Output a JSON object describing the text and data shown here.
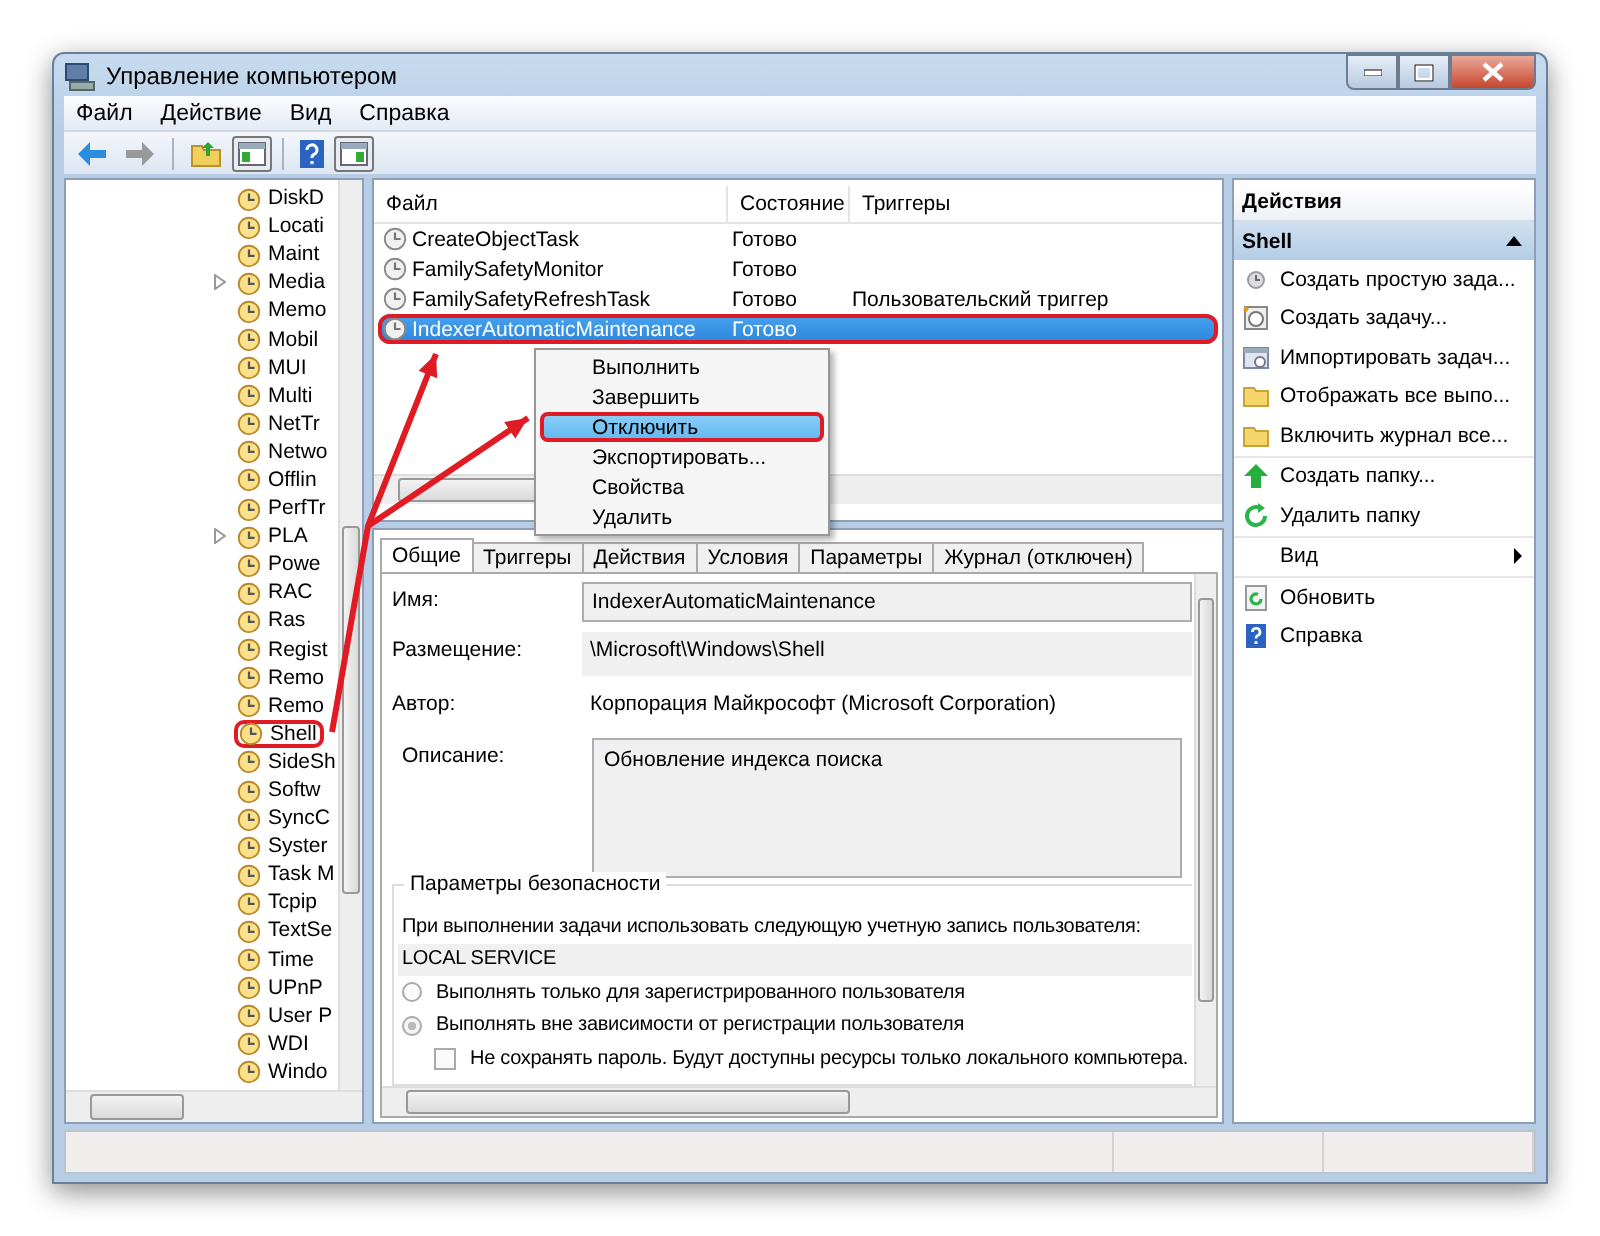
{
  "window": {
    "title": "Управление компьютером"
  },
  "menu": [
    "Файл",
    "Действие",
    "Вид",
    "Справка"
  ],
  "tree": {
    "items": [
      {
        "label": "DiskD",
        "expandable": false,
        "highlighted": false
      },
      {
        "label": "Locati",
        "expandable": false,
        "highlighted": false
      },
      {
        "label": "Maint",
        "expandable": false,
        "highlighted": false
      },
      {
        "label": "Media",
        "expandable": true,
        "highlighted": false
      },
      {
        "label": "Memo",
        "expandable": false,
        "highlighted": false
      },
      {
        "label": "Mobil",
        "expandable": false,
        "highlighted": false
      },
      {
        "label": "MUI",
        "expandable": false,
        "highlighted": false
      },
      {
        "label": "Multi",
        "expandable": false,
        "highlighted": false
      },
      {
        "label": "NetTr",
        "expandable": false,
        "highlighted": false
      },
      {
        "label": "Netwo",
        "expandable": false,
        "highlighted": false
      },
      {
        "label": "Offlin",
        "expandable": false,
        "highlighted": false
      },
      {
        "label": "PerfTr",
        "expandable": false,
        "highlighted": false
      },
      {
        "label": "PLA",
        "expandable": true,
        "highlighted": false
      },
      {
        "label": "Powe",
        "expandable": false,
        "highlighted": false
      },
      {
        "label": "RAC",
        "expandable": false,
        "highlighted": false
      },
      {
        "label": "Ras",
        "expandable": false,
        "highlighted": false
      },
      {
        "label": "Regist",
        "expandable": false,
        "highlighted": false
      },
      {
        "label": "Remo",
        "expandable": false,
        "highlighted": false
      },
      {
        "label": "Remo",
        "expandable": false,
        "highlighted": false
      },
      {
        "label": "Shell",
        "expandable": false,
        "highlighted": true
      },
      {
        "label": "SideSh",
        "expandable": false,
        "highlighted": false
      },
      {
        "label": "Softw",
        "expandable": false,
        "highlighted": false
      },
      {
        "label": "SyncC",
        "expandable": false,
        "highlighted": false
      },
      {
        "label": "Syster",
        "expandable": false,
        "highlighted": false
      },
      {
        "label": "Task M",
        "expandable": false,
        "highlighted": false
      },
      {
        "label": "Tcpip",
        "expandable": false,
        "highlighted": false
      },
      {
        "label": "TextSe",
        "expandable": false,
        "highlighted": false
      },
      {
        "label": "Time",
        "expandable": false,
        "highlighted": false
      },
      {
        "label": "UPnP",
        "expandable": false,
        "highlighted": false
      },
      {
        "label": "User P",
        "expandable": false,
        "highlighted": false
      },
      {
        "label": "WDI",
        "expandable": false,
        "highlighted": false
      },
      {
        "label": "Windo",
        "expandable": false,
        "highlighted": false
      }
    ]
  },
  "tasks": {
    "columns": [
      "Файл",
      "Состояние",
      "Триггеры"
    ],
    "rows": [
      {
        "name": "CreateObjectTask",
        "status": "Готово",
        "selected": false,
        "highlighted": false
      },
      {
        "name": "FamilySafetyMonitor",
        "status": "Готово",
        "selected": false,
        "highlighted": false
      },
      {
        "name": "FamilySafetyRefreshTask",
        "status": "Готово",
        "triggers": "Пользовательский триггер",
        "selected": false,
        "highlighted": false
      },
      {
        "name": "IndexerAutomaticMaintenance",
        "status": "Готово",
        "selected": true,
        "highlighted": true
      }
    ]
  },
  "context_menu": {
    "items": [
      {
        "label": "Выполнить",
        "selected": false,
        "highlighted": false
      },
      {
        "label": "Завершить",
        "selected": false,
        "highlighted": false
      },
      {
        "label": "Отключить",
        "selected": true,
        "highlighted": true
      },
      {
        "label": "Экспортировать...",
        "selected": false,
        "highlighted": false
      },
      {
        "label": "Свойства",
        "selected": false,
        "highlighted": false
      },
      {
        "label": "Удалить",
        "selected": false,
        "highlighted": false
      }
    ]
  },
  "details": {
    "tabs": [
      {
        "label": "Общие",
        "selected": true
      },
      {
        "label": "Триггеры",
        "selected": false
      },
      {
        "label": "Действия",
        "selected": false
      },
      {
        "label": "Условия",
        "selected": false
      },
      {
        "label": "Параметры",
        "selected": false
      },
      {
        "label": "Журнал (отключен)",
        "selected": false
      }
    ],
    "fields": [
      {
        "label": "Имя:",
        "value": "IndexerAutomaticMaintenance",
        "kind": "field"
      },
      {
        "label": "Размещение:",
        "value": "\\Microsoft\\Windows\\Shell",
        "kind": "readonly"
      },
      {
        "label": "Автор:",
        "value": "Корпорация Майкрософт (Microsoft Corporation)",
        "kind": "text"
      },
      {
        "label": "Описание:",
        "value": "Обновление индекса поиска",
        "kind": "area"
      }
    ],
    "security": {
      "title": "Параметры безопасности",
      "prompt": "При выполнении задачи использовать следующую учетную запись пользователя:",
      "account": "LOCAL SERVICE",
      "options": [
        {
          "label": "Выполнять только для зарегистрированного пользователя",
          "selected": false
        },
        {
          "label": "Выполнять вне зависимости от регистрации пользователя",
          "selected": true
        }
      ],
      "no_password": {
        "label": "Не сохранять пароль. Будут доступны ресурсы только локального компьютера.",
        "checked": false
      }
    }
  },
  "actions": {
    "title": "Действия",
    "section": {
      "label": "Shell",
      "expanded": true
    },
    "items": [
      {
        "label": "Создать простую зада...",
        "kind": "item"
      },
      {
        "label": "Создать задачу...",
        "kind": "item"
      },
      {
        "label": "Импортировать задач...",
        "kind": "item"
      },
      {
        "label": "Отображать все выпо...",
        "kind": "item"
      },
      {
        "label": "Включить журнал все...",
        "kind": "item"
      },
      {
        "label": "Создать папку...",
        "kind": "item"
      },
      {
        "label": "Удалить папку",
        "kind": "item"
      },
      {
        "label": "Вид",
        "kind": "submenu"
      },
      {
        "label": "Обновить",
        "kind": "item"
      },
      {
        "label": "Справка",
        "kind": "item"
      }
    ]
  }
}
